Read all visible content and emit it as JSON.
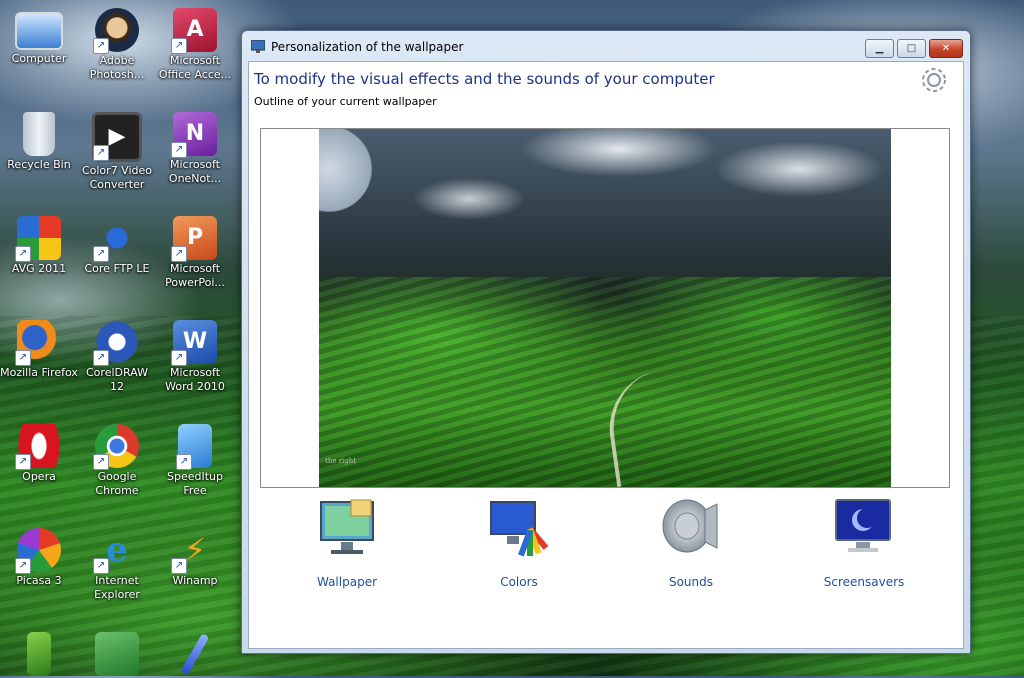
{
  "desktop": {
    "icons": [
      {
        "label": "Computer",
        "icon": "computer-icon"
      },
      {
        "label": "Adobe Photosh...",
        "icon": "photoshop-icon"
      },
      {
        "label": "Microsoft Office Acce...",
        "icon": "access-icon"
      },
      {
        "label": "Recycle Bin",
        "icon": "recycle-bin-icon"
      },
      {
        "label": "Color7 Video Converter",
        "icon": "video-converter-icon"
      },
      {
        "label": "Microsoft OneNot...",
        "icon": "onenote-icon"
      },
      {
        "label": "AVG 2011",
        "icon": "avg-icon"
      },
      {
        "label": "Core FTP LE",
        "icon": "ftp-icon"
      },
      {
        "label": "Microsoft PowerPoi...",
        "icon": "powerpoint-icon"
      },
      {
        "label": "Mozilla Firefox",
        "icon": "firefox-icon"
      },
      {
        "label": "CorelDRAW 12",
        "icon": "coreldraw-icon"
      },
      {
        "label": "Microsoft Word 2010",
        "icon": "word-icon"
      },
      {
        "label": "Opera",
        "icon": "opera-icon"
      },
      {
        "label": "Google Chrome",
        "icon": "chrome-icon"
      },
      {
        "label": "SpeedItup Free",
        "icon": "speeditup-icon"
      },
      {
        "label": "Picasa 3",
        "icon": "picasa-icon"
      },
      {
        "label": "Internet Explorer",
        "icon": "ie-icon"
      },
      {
        "label": "Winamp",
        "icon": "winamp-icon"
      }
    ]
  },
  "window": {
    "title": "Personalization of the wallpaper",
    "heading": "To modify the visual effects and the sounds of your computer",
    "subheading": "Outline of your current wallpaper",
    "preview_watermark": "the right",
    "options": [
      {
        "label": "Wallpaper",
        "icon": "wallpaper-icon"
      },
      {
        "label": "Colors",
        "icon": "colors-icon"
      },
      {
        "label": "Sounds",
        "icon": "sounds-icon"
      },
      {
        "label": "Screensavers",
        "icon": "screensavers-icon"
      }
    ]
  },
  "colors": {
    "heading_text": "#1e3287",
    "link_text": "#1e4f9e",
    "close_button": "#c4452b"
  }
}
